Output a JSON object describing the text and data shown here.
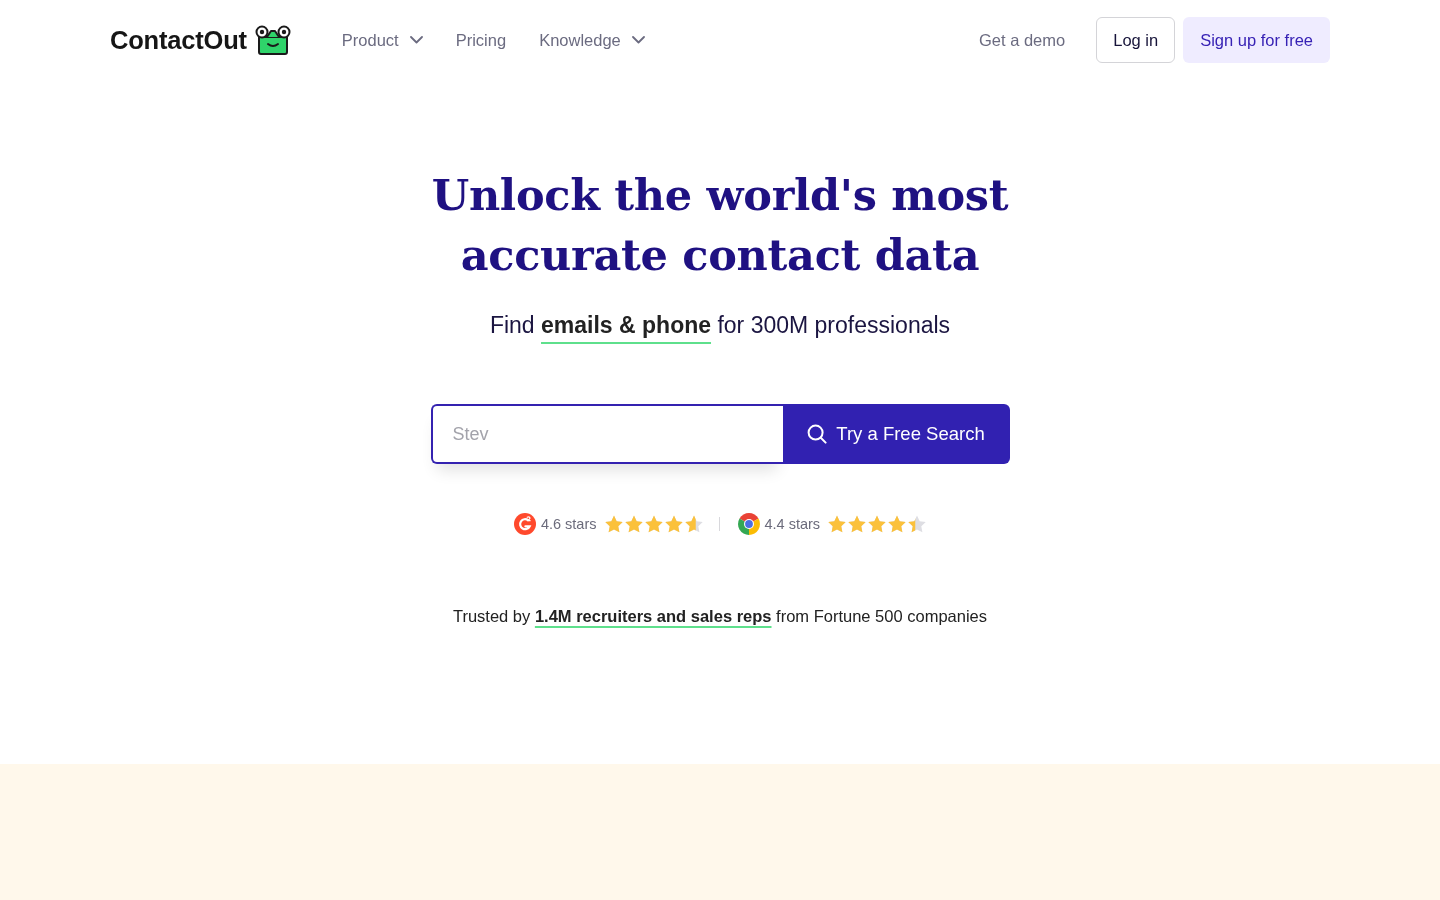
{
  "nav": {
    "logo": "ContactOut",
    "items": [
      {
        "label": "Product",
        "dropdown": true
      },
      {
        "label": "Pricing",
        "dropdown": false
      },
      {
        "label": "Knowledge",
        "dropdown": true
      }
    ],
    "demo_link": "Get a demo",
    "login_button": "Log in",
    "signup_button": "Sign up for free"
  },
  "hero": {
    "title": "Unlock the world's most accurate contact data",
    "subtitle": "Find **emails & phone** for 300M professionals",
    "search": {
      "placeholder": "Stev",
      "button": "Try a Free Search"
    },
    "ratings": [
      {
        "kind": "g2",
        "label": "4.6 stars",
        "stars": 4.6
      },
      {
        "kind": "chrome",
        "label": "4.4 stars",
        "stars": 4.4
      }
    ],
    "trusted": "Trusted by **1.4M recruiters and sales reps** from Fortune 500 companies"
  }
}
